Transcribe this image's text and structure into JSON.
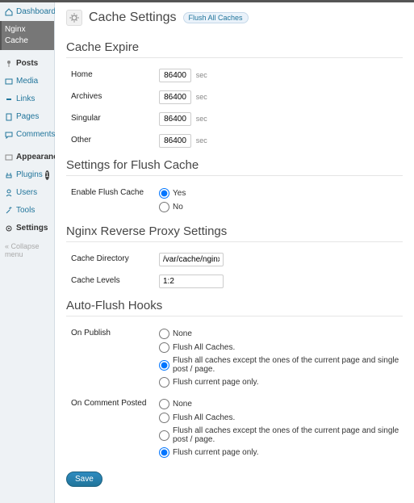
{
  "sidebar": {
    "dashboard": "Dashboard",
    "nginx_cache": "Nginx Cache",
    "posts": "Posts",
    "media": "Media",
    "links": "Links",
    "pages": "Pages",
    "comments": "Comments",
    "appearance": "Appearance",
    "plugins": "Plugins",
    "plugins_badge": "1",
    "users": "Users",
    "tools": "Tools",
    "settings": "Settings",
    "collapse": "Collapse menu"
  },
  "page": {
    "title": "Cache Settings",
    "flush_button": "Flush All Caches"
  },
  "sections": {
    "expire": "Cache Expire",
    "flush_settings": "Settings for Flush Cache",
    "reverse_proxy": "Nginx Reverse Proxy Settings",
    "auto_flush": "Auto-Flush Hooks"
  },
  "expire": {
    "home_label": "Home",
    "home_value": "86400",
    "archives_label": "Archives",
    "archives_value": "86400",
    "singular_label": "Singular",
    "singular_value": "86400",
    "other_label": "Other",
    "other_value": "86400",
    "unit": "sec"
  },
  "flush": {
    "enable_label": "Enable Flush Cache",
    "yes": "Yes",
    "no": "No"
  },
  "proxy": {
    "cache_dir_label": "Cache Directory",
    "cache_dir_value": "/var/cache/nginx",
    "cache_levels_label": "Cache Levels",
    "cache_levels_value": "1:2"
  },
  "hooks": {
    "on_publish_label": "On Publish",
    "on_comment_label": "On Comment Posted",
    "opt_none": "None",
    "opt_flush_all": "Flush All Caches.",
    "opt_flush_except": "Flush all caches except the ones of the current page and single post / page.",
    "opt_flush_current": "Flush current page only."
  },
  "save": "Save"
}
